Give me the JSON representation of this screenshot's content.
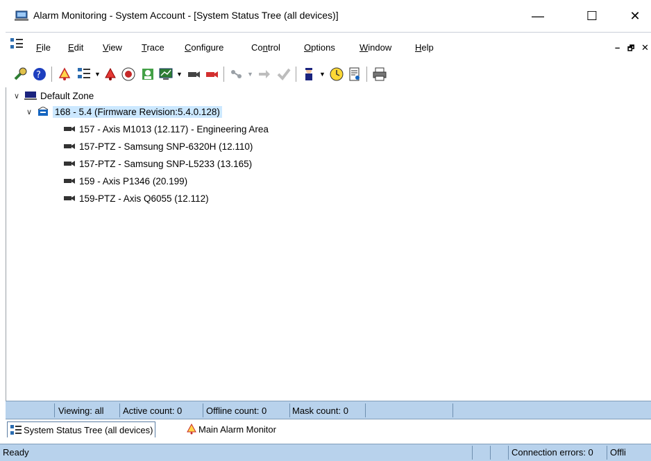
{
  "window": {
    "title": "Alarm Monitoring - System Account - [System Status Tree (all devices)]",
    "minimize": "—",
    "maximize": "☐",
    "close": "✕"
  },
  "menu": {
    "items": [
      {
        "mnemonic": "F",
        "rest": "ile"
      },
      {
        "mnemonic": "E",
        "rest": "dit"
      },
      {
        "mnemonic": "V",
        "rest": "iew"
      },
      {
        "mnemonic": "T",
        "rest": "race"
      },
      {
        "mnemonic": "C",
        "rest": "onfigure"
      },
      {
        "pre": "Co",
        "mnemonic": "n",
        "rest": "trol"
      },
      {
        "mnemonic": "O",
        "rest": "ptions"
      },
      {
        "mnemonic": "W",
        "rest": "indow"
      },
      {
        "mnemonic": "H",
        "rest": "elp"
      }
    ],
    "mdi_min": "–",
    "mdi_restore": "🗗",
    "mdi_close": "✕"
  },
  "toolbar": {
    "icons": [
      "wrench-icon",
      "help-icon",
      "alarm-bell-icon",
      "device-tree-icon",
      "alarm-red-icon",
      "record-icon",
      "badge-icon",
      "monitor-icon",
      "camera-icon",
      "camera-red-icon",
      "network-icon",
      "arrow-icon",
      "acknowledge-icon",
      "guard-icon",
      "clock-icon",
      "report-icon",
      "print-icon"
    ]
  },
  "tree": {
    "zone": "Default Zone",
    "panel": "168 - 5.4 (Firmware Revision:5.4.0.128)",
    "cameras": [
      "157 - Axis M1013 (12.117) - Engineering Area",
      "157-PTZ - Samsung SNP-6320H (12.110)",
      "157-PTZ - Samsung SNP-L5233 (13.165)",
      "159 - Axis P1346 (20.199)",
      "159-PTZ - Axis Q6055 (12.112)"
    ]
  },
  "status_counts": {
    "viewing": "Viewing: all",
    "active": "Active count: 0",
    "offline": "Offline count: 0",
    "mask": "Mask count: 0"
  },
  "tabs": [
    {
      "label": "System Status Tree (all devices)"
    },
    {
      "label": "Main Alarm Monitor"
    }
  ],
  "statusbar": {
    "ready": "Ready",
    "connection_errors": "Connection errors: 0",
    "offline_partial": "Offli"
  },
  "colors": {
    "status_bar": "#b8d2ec",
    "selection": "#cce8ff"
  }
}
